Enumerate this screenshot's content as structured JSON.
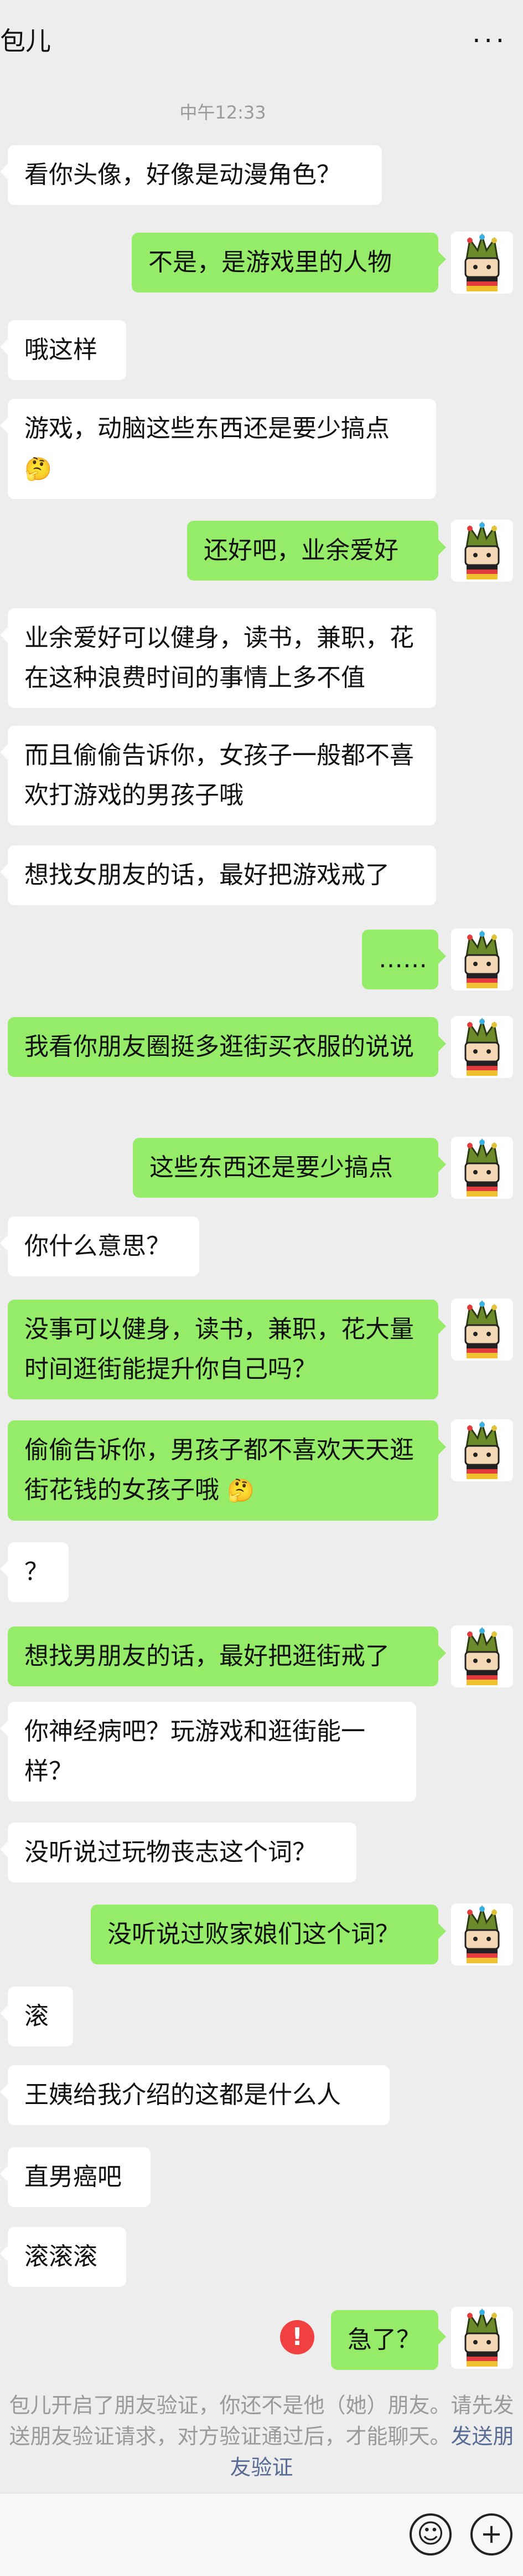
{
  "header": {
    "title": "包儿",
    "more_label": "···"
  },
  "timestamp": "中午12:33",
  "messages": [
    {
      "side": "left",
      "text": "看你头像，好像是动漫角色？"
    },
    {
      "side": "right",
      "text": "不是，是游戏里的人物"
    },
    {
      "side": "left",
      "text": "哦这样"
    },
    {
      "side": "left",
      "text": "游戏，动脑这些东西还是要少搞点",
      "emoji": "🤔"
    },
    {
      "side": "right",
      "text": "还好吧，业余爱好"
    },
    {
      "side": "left",
      "text": "业余爱好可以健身，读书，兼职，花在这种浪费时间的事情上多不值"
    },
    {
      "side": "left",
      "text": "而且偷偷告诉你，女孩子一般都不喜欢打游戏的男孩子哦"
    },
    {
      "side": "left",
      "text": "想找女朋友的话，最好把游戏戒了"
    },
    {
      "side": "right",
      "text": "……"
    },
    {
      "side": "right",
      "text": "我看你朋友圈挺多逛街买衣服的说说"
    },
    {
      "side": "right",
      "text": "这些东西还是要少搞点"
    },
    {
      "side": "left",
      "text": "你什么意思？"
    },
    {
      "side": "right",
      "text": "没事可以健身，读书，兼职，花大量时间逛街能提升你自己吗？"
    },
    {
      "side": "right",
      "text": "偷偷告诉你，男孩子都不喜欢天天逛街花钱的女孩子哦",
      "emoji": "🤔"
    },
    {
      "side": "left",
      "text": "？"
    },
    {
      "side": "right",
      "text": "想找男朋友的话，最好把逛街戒了"
    },
    {
      "side": "left",
      "text": "你神经病吧？玩游戏和逛街能一样？"
    },
    {
      "side": "left",
      "text": "没听说过玩物丧志这个词？"
    },
    {
      "side": "right",
      "text": "没听说过败家娘们这个词？"
    },
    {
      "side": "left",
      "text": "滚"
    },
    {
      "side": "left",
      "text": "王姨给我介绍的这都是什么人"
    },
    {
      "side": "left",
      "text": "直男癌吧"
    },
    {
      "side": "left",
      "text": "滚滚滚"
    },
    {
      "side": "right",
      "text": "急了？"
    }
  ],
  "send_failed_icon": "!",
  "notice": {
    "text": "包儿开启了朋友验证，你还不是他（她）朋友。请先发送朋友验证请求，对方验证通过后，才能聊天。",
    "link": "发送朋友验证"
  },
  "input_bar": {
    "emoji_icon": "☺",
    "plus_icon": "+"
  },
  "colors": {
    "background": "#ededed",
    "self_bubble": "#95ec69",
    "other_bubble": "#ffffff",
    "error": "#f04040",
    "link": "#576b95"
  }
}
